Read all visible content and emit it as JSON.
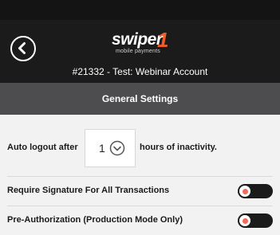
{
  "header": {
    "logo_word": "swiper",
    "logo_number": "1",
    "logo_tagline": "mobile payments",
    "account": "#21332 - Test: Webinar Account",
    "icons": {
      "back": "back-chevron-circle-icon"
    }
  },
  "section": {
    "title": "General Settings"
  },
  "settings": {
    "auto_logout": {
      "prefix": "Auto logout after",
      "value": "1",
      "suffix": "hours of inactivity.",
      "icon": "chevron-down-circle-icon"
    },
    "require_signature": {
      "label": "Require Signature For All Transactions",
      "enabled": false
    },
    "pre_authorization": {
      "label": "Pre-Authorization (Production Mode Only)",
      "enabled": false
    }
  },
  "colors": {
    "header_bg": "#1b1b1b",
    "section_bg": "#4d4d4f",
    "page_bg": "#f2f2f2",
    "brand_accent": "#f15a29",
    "toggle_dot": "#f26a5a"
  }
}
